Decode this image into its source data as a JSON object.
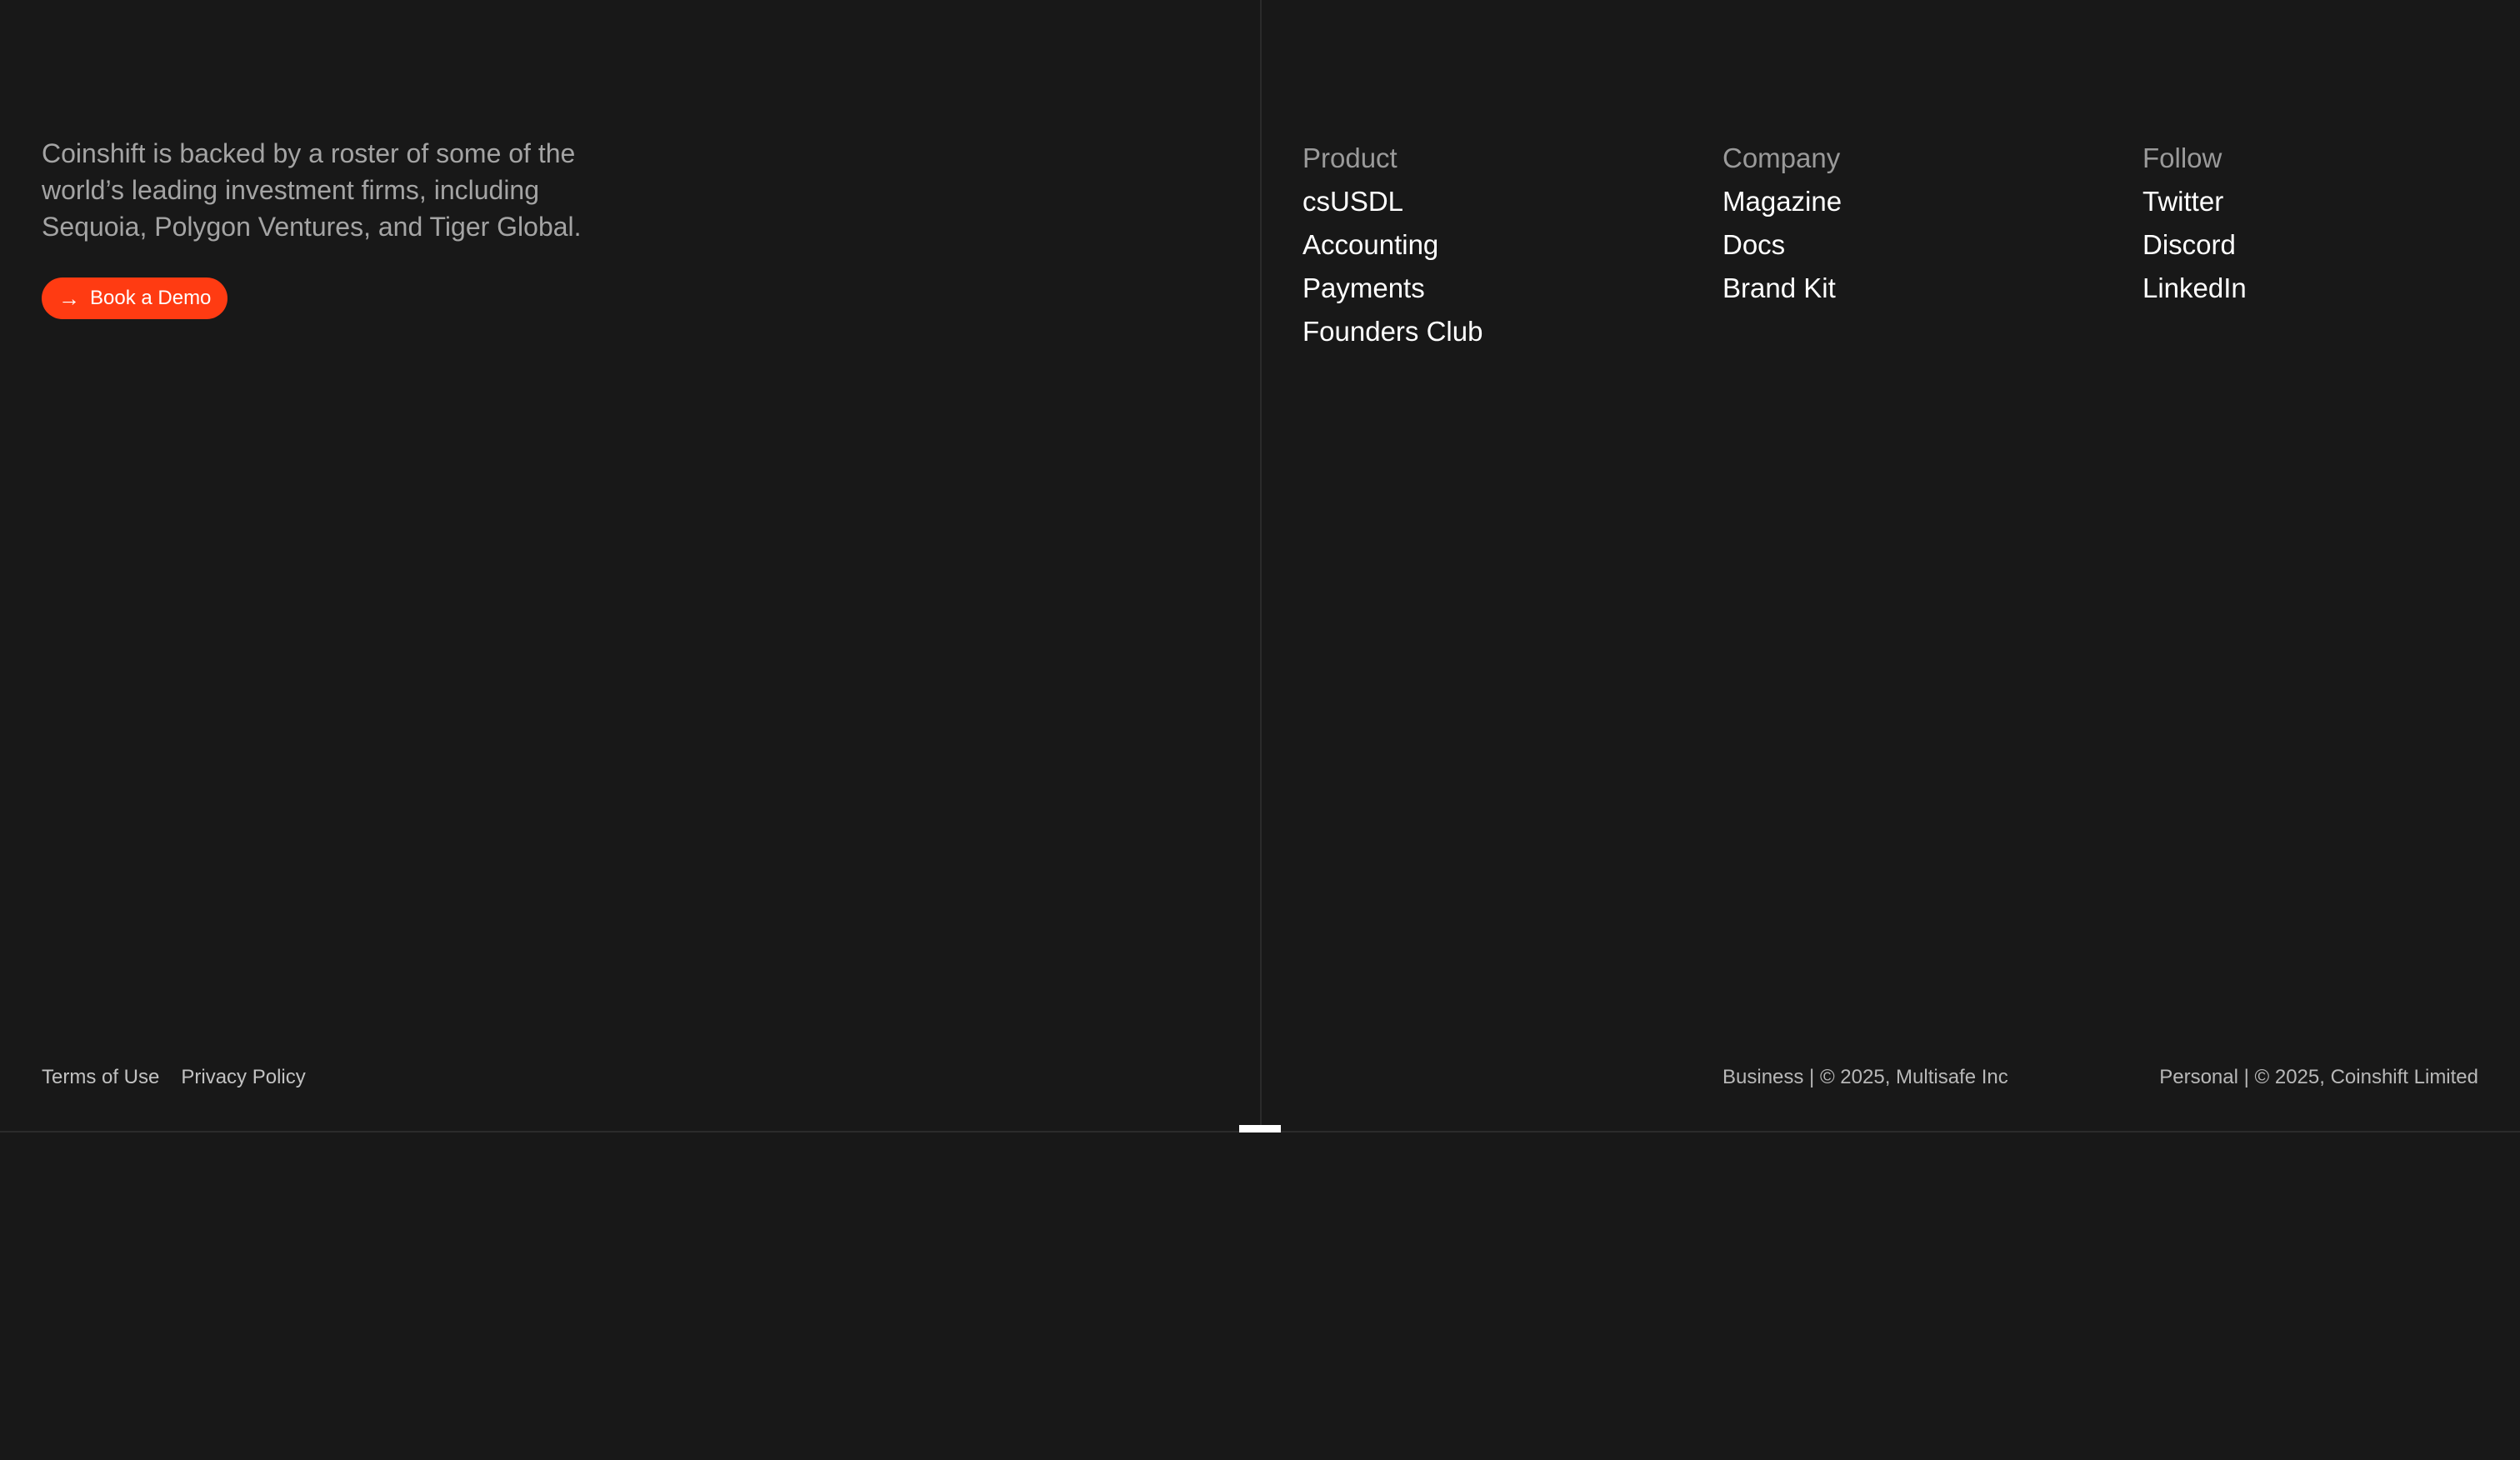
{
  "intro": {
    "text": "Coinshift is backed by a roster of some of the world’s leading investment firms, including Sequoia, Polygon Ventures, and Tiger Global."
  },
  "cta": {
    "label": "Book a Demo",
    "icon": "arrow-right-icon",
    "color": "#FF3B12"
  },
  "columns": [
    {
      "heading": "Product",
      "links": [
        "csUSDL",
        "Accounting",
        "Payments",
        "Founders Club"
      ]
    },
    {
      "heading": "Company",
      "links": [
        "Magazine",
        "Docs",
        "Brand Kit"
      ]
    },
    {
      "heading": "Follow",
      "links": [
        "Twitter",
        "Discord",
        "LinkedIn"
      ]
    }
  ],
  "legal": {
    "terms": "Terms of Use",
    "privacy": "Privacy Policy"
  },
  "copyright": {
    "business": "Business | © 2025, Multisafe Inc",
    "personal": "Personal | © 2025, Coinshift Limited"
  },
  "colors": {
    "background": "#181818",
    "divider": "#2B2B2B",
    "accent": "#FF3B12"
  }
}
